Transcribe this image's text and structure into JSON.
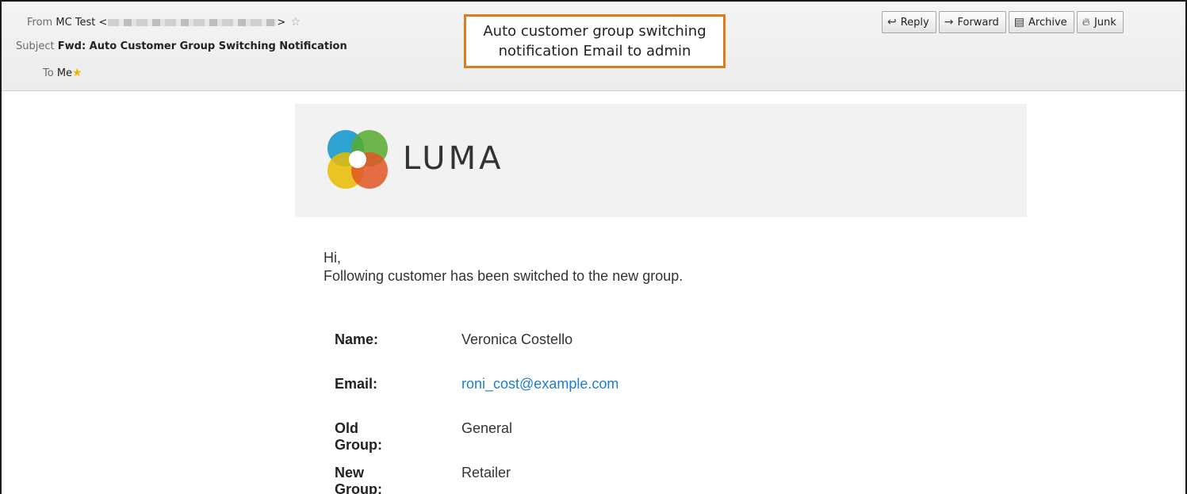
{
  "header": {
    "from_label": "From",
    "from_value": "MC Test <",
    "from_value_end": ">",
    "subject_label": "Subject",
    "subject_value": "Fwd: Auto Customer Group Switching Notification",
    "to_label": "To",
    "to_value": "Me"
  },
  "annotation": {
    "line1": "Auto customer group switching",
    "line2": "notification Email to admin"
  },
  "toolbar": {
    "reply": "Reply",
    "forward": "Forward",
    "archive": "Archive",
    "junk": "Junk"
  },
  "email": {
    "logo_text": "LUMA",
    "greeting": "Hi,",
    "message": "Following customer has been switched to the new group.",
    "name_label": "Name:",
    "name_value": "Veronica Costello",
    "email_label": "Email:",
    "email_value": "roni_cost@example.com",
    "old_group_label": "Old Group:",
    "old_group_value": "General",
    "new_group_label": "New Group:",
    "new_group_value": "Retailer"
  },
  "colors": {
    "annotation_border": "#e07a1f",
    "link": "#1e7ec8",
    "star": "#f2b400"
  },
  "icons": [
    "star-outline-icon",
    "star-icon",
    "reply-icon",
    "forward-icon",
    "archive-icon",
    "junk-icon",
    "luma-logo"
  ]
}
